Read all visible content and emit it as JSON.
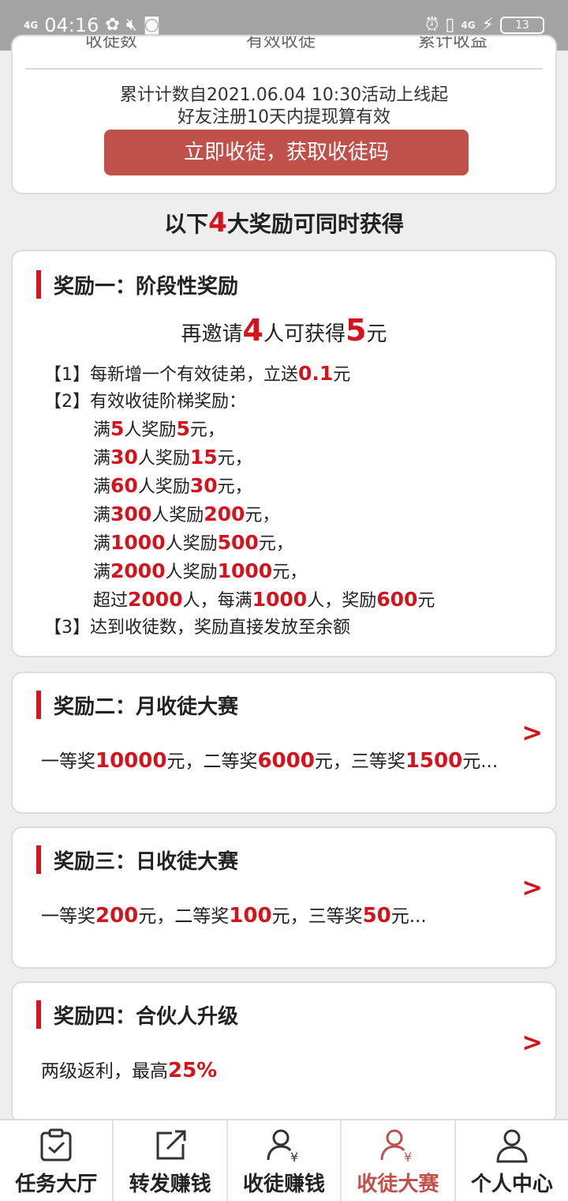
{
  "status_bar": {
    "network_left": "4G",
    "time": "04:16",
    "network_right": "4G",
    "battery": "13"
  },
  "top_card": {
    "tabs_cut": [
      "收徒数",
      "有效收徒",
      "累计收益"
    ],
    "info_line1": "累计计数自2021.06.04 10:30活动上线起",
    "info_line2": "好友注册10天内提现算有效",
    "button_label": "立即收徒，获取收徒码"
  },
  "headline": {
    "prefix": "以下",
    "number": "4",
    "suffix": "大奖励可同时获得"
  },
  "reward1": {
    "title": "奖励一：阶段性奖励",
    "invite_prefix": "再邀请",
    "invite_count": "4",
    "invite_mid": "人可获得",
    "invite_amount": "5",
    "invite_suffix": "元",
    "rules": {
      "r1_prefix": "【1】每新增一个有效徒弟，立送",
      "r1_amount": "0.1",
      "r1_suffix": "元",
      "r2_text": "【2】有效收徒阶梯奖励：",
      "tiers": [
        {
          "a": "满",
          "n": "5",
          "b": "人奖励",
          "m": "5",
          "c": "元，"
        },
        {
          "a": "满",
          "n": "30",
          "b": "人奖励",
          "m": "15",
          "c": "元，"
        },
        {
          "a": "满",
          "n": "60",
          "b": "人奖励",
          "m": "30",
          "c": "元，"
        },
        {
          "a": "满",
          "n": "300",
          "b": "人奖励",
          "m": "200",
          "c": "元，"
        },
        {
          "a": "满",
          "n": "1000",
          "b": "人奖励",
          "m": "500",
          "c": "元，"
        },
        {
          "a": "满",
          "n": "2000",
          "b": "人奖励",
          "m": "1000",
          "c": "元，"
        }
      ],
      "over": {
        "a": "超过",
        "n": "2000",
        "b": "人，每满",
        "n2": "1000",
        "c": "人，奖励",
        "m": "600",
        "d": "元"
      },
      "r3_text": "【3】达到收徒数，奖励直接发放至余额"
    }
  },
  "reward2": {
    "title": "奖励二：月收徒大赛",
    "p1": "一等奖",
    "v1": "10000",
    "p2": "元，二等奖",
    "v2": "6000",
    "p3": "元，三等奖",
    "v3": "1500",
    "p4": "元..."
  },
  "reward3": {
    "title": "奖励三：日收徒大赛",
    "p1": "一等奖",
    "v1": "200",
    "p2": "元，二等奖",
    "v2": "100",
    "p3": "元，三等奖",
    "v3": "50",
    "p4": "元..."
  },
  "reward4": {
    "title": "奖励四：合伙人升级",
    "p1": "两级返利，最高",
    "v1": "25%"
  },
  "arrow_glyph": ">",
  "bottom_nav": [
    {
      "label": "任务大厅",
      "icon": "task-hall-icon"
    },
    {
      "label": "转发赚钱",
      "icon": "share-icon"
    },
    {
      "label": "收徒赚钱",
      "icon": "recruit-money-icon"
    },
    {
      "label": "收徒大赛",
      "icon": "recruit-contest-icon"
    },
    {
      "label": "个人中心",
      "icon": "profile-icon"
    }
  ],
  "colors": {
    "accent": "#d4141c",
    "button": "#c0504a",
    "background": "#eeeeee"
  }
}
